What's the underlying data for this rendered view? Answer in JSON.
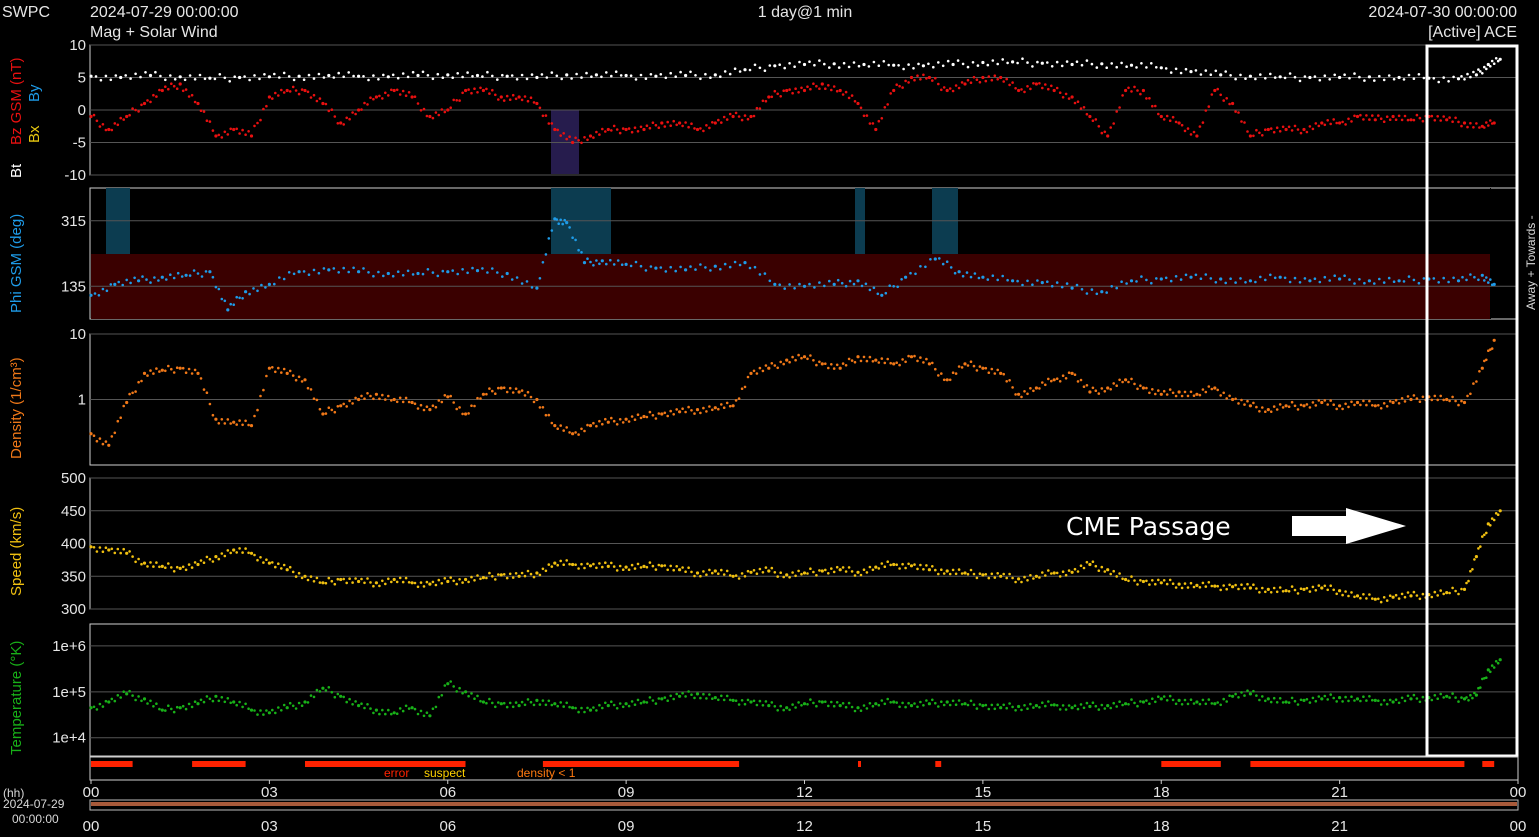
{
  "header": {
    "brand": "SWPC",
    "start_time": "2024-07-29 00:00:00",
    "product": "Mag + Solar Wind",
    "resolution": "1 day@1 min",
    "end_time": "2024-07-30 00:00:00",
    "source": "[Active] ACE"
  },
  "annotation": {
    "text": "CME Passage"
  },
  "right_label": "Away + Towards -",
  "quality_legend": {
    "error": "error",
    "suspect": "suspect",
    "density": "density < 1"
  },
  "bottom_axis": {
    "unit": "(hh)",
    "date": "2024-07-29",
    "time": "00:00:00"
  },
  "colors": {
    "bt": "#ffffff",
    "bz": "#e81010",
    "by": "#1e9be8",
    "bx": "#e8c810",
    "phi": "#1e9be8",
    "density": "#f07818",
    "speed": "#f0c010",
    "temperature": "#18b018",
    "error": "#ff2200",
    "suspect": "#ffd200",
    "density_low": "#ff7a10"
  },
  "chart_data": [
    {
      "type": "scatter",
      "panel": "mag",
      "ylabels": [
        "Bt",
        "Bz GSM (nT)",
        "By",
        "Bx"
      ],
      "yticks": [
        "10",
        "5",
        "0",
        "-5",
        "-10"
      ],
      "ylim": [
        -10,
        10
      ],
      "x_unit": "hours",
      "series": [
        {
          "name": "Bt",
          "x": [
            0,
            0.5,
            1,
            1.5,
            2,
            2.5,
            3,
            3.5,
            4,
            4.5,
            5,
            5.5,
            6,
            6.5,
            7,
            7.5,
            8,
            8.5,
            9,
            9.5,
            10,
            10.5,
            11,
            11.5,
            12,
            12.5,
            13,
            13.5,
            14,
            14.5,
            15,
            15.5,
            16,
            16.5,
            17,
            17.5,
            18,
            18.5,
            19,
            19.5,
            20,
            20.5,
            21,
            21.5,
            22,
            22.5,
            23,
            23.3,
            23.5,
            23.7
          ],
          "y": [
            5.2,
            5.0,
            5.3,
            5.1,
            4.9,
            5.0,
            5.1,
            5.2,
            5.3,
            5.2,
            5.1,
            5.3,
            5.4,
            5.3,
            5.2,
            5.0,
            5.4,
            5.4,
            5.3,
            5.2,
            5.3,
            5.4,
            6.2,
            6.8,
            7.0,
            7.1,
            7.0,
            6.9,
            6.8,
            7.0,
            7.3,
            7.4,
            7.2,
            7.0,
            7.1,
            6.9,
            6.5,
            5.9,
            5.4,
            5.2,
            5.1,
            5.0,
            5.0,
            5.1,
            5.0,
            4.9,
            4.8,
            5.4,
            7.0,
            7.8
          ]
        },
        {
          "name": "Bz GSM (nT)",
          "x": [
            0,
            0.3,
            0.6,
            0.9,
            1.2,
            1.5,
            1.8,
            2.1,
            2.4,
            2.7,
            3.0,
            3.3,
            3.6,
            3.9,
            4.2,
            4.5,
            4.8,
            5.1,
            5.4,
            5.7,
            6.0,
            6.3,
            6.6,
            6.9,
            7.2,
            7.5,
            7.8,
            8.1,
            8.4,
            8.7,
            9.0,
            9.3,
            9.6,
            9.9,
            10.2,
            10.5,
            10.8,
            11.1,
            11.4,
            11.7,
            12.0,
            12.3,
            12.6,
            12.9,
            13.2,
            13.5,
            13.8,
            14.1,
            14.4,
            14.7,
            15.0,
            15.3,
            15.6,
            15.9,
            16.2,
            16.5,
            16.8,
            17.1,
            17.4,
            17.7,
            18.0,
            18.3,
            18.6,
            18.9,
            19.2,
            19.5,
            19.8,
            20.1,
            20.4,
            20.7,
            21.0,
            21.3,
            21.6,
            21.9,
            22.2,
            22.5,
            22.8,
            23.1,
            23.4,
            23.6
          ],
          "y": [
            -1,
            -3,
            -1,
            1,
            3,
            4,
            1,
            -4,
            -3,
            -4,
            2,
            3,
            3,
            1,
            -2,
            0,
            2,
            3,
            2,
            -1,
            0,
            3,
            3,
            2,
            2,
            1,
            -3,
            -5,
            -4,
            -3,
            -3,
            -3,
            -2,
            -2,
            -3,
            -2,
            -1,
            -1,
            2,
            3,
            3,
            4,
            3,
            1,
            -3,
            3,
            5,
            5,
            3,
            4,
            5,
            5,
            3,
            4,
            3,
            2,
            -1,
            -4,
            3,
            3,
            -1,
            -2,
            -4,
            3,
            1,
            -4,
            -3,
            -3,
            -3,
            -2,
            -2,
            -1,
            -1.5,
            -1,
            -1.5,
            -1,
            -1.5,
            -2,
            -2.5,
            -2
          ]
        }
      ]
    },
    {
      "type": "scatter",
      "panel": "phi",
      "ylabels": [
        "Phi GSM (deg)"
      ],
      "yticks": [
        "315",
        "135"
      ],
      "ylim": [
        45,
        405
      ],
      "x_unit": "hours",
      "series": [
        {
          "name": "Phi GSM (deg)",
          "x": [
            0,
            0.4,
            0.8,
            1.2,
            1.6,
            2.0,
            2.3,
            2.6,
            3.0,
            3.5,
            4.0,
            4.5,
            5.0,
            5.5,
            6.0,
            6.5,
            7.0,
            7.5,
            7.8,
            8.0,
            8.3,
            8.6,
            9.0,
            9.5,
            10.0,
            10.5,
            11.0,
            11.5,
            12.0,
            12.5,
            12.9,
            13.3,
            13.7,
            14.2,
            14.6,
            15.0,
            15.5,
            16.0,
            16.5,
            17.0,
            17.5,
            18.0,
            18.5,
            19.0,
            19.5,
            20.0,
            20.5,
            21.0,
            21.5,
            22.0,
            22.5,
            23.0,
            23.4,
            23.6
          ],
          "y": [
            110,
            140,
            150,
            160,
            165,
            175,
            70,
            120,
            140,
            175,
            180,
            175,
            170,
            170,
            175,
            178,
            170,
            130,
            320,
            310,
            200,
            205,
            195,
            185,
            180,
            190,
            200,
            140,
            135,
            140,
            150,
            110,
            160,
            210,
            175,
            160,
            150,
            145,
            130,
            120,
            150,
            155,
            160,
            155,
            150,
            160,
            150,
            155,
            150,
            150,
            155,
            150,
            165,
            140
          ]
        }
      ]
    },
    {
      "type": "scatter",
      "panel": "density",
      "ylabels": [
        "Density (1/cm³)"
      ],
      "yticks": [
        "10",
        "1"
      ],
      "yscale": "log",
      "ylim": [
        0.1,
        10
      ],
      "x_unit": "hours",
      "series": [
        {
          "name": "Density (1/cm³)",
          "x": [
            0,
            0.3,
            0.6,
            0.9,
            1.2,
            1.5,
            1.8,
            2.1,
            2.4,
            2.7,
            3.0,
            3.3,
            3.6,
            3.9,
            4.2,
            4.5,
            4.8,
            5.1,
            5.4,
            5.7,
            6.0,
            6.3,
            6.6,
            6.9,
            7.2,
            7.5,
            7.8,
            8.1,
            8.4,
            8.7,
            9.0,
            9.3,
            9.6,
            9.9,
            10.2,
            10.5,
            10.8,
            11.1,
            11.4,
            11.7,
            12.0,
            12.3,
            12.6,
            12.9,
            13.2,
            13.5,
            13.8,
            14.1,
            14.4,
            14.7,
            15.0,
            15.3,
            15.6,
            15.9,
            16.2,
            16.5,
            16.8,
            17.1,
            17.4,
            17.7,
            18.0,
            18.3,
            18.6,
            18.9,
            19.2,
            19.5,
            19.8,
            20.1,
            20.4,
            20.7,
            21.0,
            21.3,
            21.6,
            21.9,
            22.2,
            22.5,
            22.8,
            23.1,
            23.4,
            23.6
          ],
          "y": [
            0.3,
            0.2,
            0.9,
            2.5,
            2.8,
            3.0,
            2.5,
            0.5,
            0.45,
            0.4,
            3.0,
            2.5,
            2.0,
            0.6,
            0.8,
            1.0,
            1.2,
            1.0,
            0.9,
            0.7,
            1.1,
            0.6,
            1.2,
            1.5,
            1.3,
            1.0,
            0.4,
            0.3,
            0.4,
            0.45,
            0.5,
            0.55,
            0.6,
            0.65,
            0.7,
            0.75,
            0.8,
            2.5,
            3.0,
            4.0,
            4.5,
            3.5,
            3.0,
            4.5,
            4.0,
            3.5,
            4.5,
            3.5,
            2.0,
            3.5,
            3.0,
            2.5,
            1.2,
            1.5,
            2.0,
            2.5,
            1.3,
            1.5,
            2.0,
            1.5,
            1.2,
            1.3,
            1.2,
            1.5,
            1.0,
            0.8,
            0.7,
            0.8,
            0.8,
            0.9,
            0.8,
            0.9,
            0.8,
            0.9,
            1.0,
            1.1,
            1.0,
            0.9,
            3.0,
            8.0
          ]
        }
      ]
    },
    {
      "type": "scatter",
      "panel": "speed",
      "ylabels": [
        "Speed (km/s)"
      ],
      "yticks": [
        "500",
        "450",
        "400",
        "350",
        "300"
      ],
      "ylim": [
        300,
        500
      ],
      "x_unit": "hours",
      "series": [
        {
          "name": "Speed (km/s)",
          "x": [
            0,
            0.3,
            0.6,
            0.9,
            1.2,
            1.5,
            1.8,
            2.1,
            2.4,
            2.7,
            3.0,
            3.3,
            3.6,
            3.9,
            4.2,
            4.5,
            4.8,
            5.1,
            5.4,
            5.7,
            6.0,
            6.3,
            6.6,
            6.9,
            7.2,
            7.5,
            7.8,
            8.1,
            8.4,
            8.7,
            9.0,
            9.3,
            9.6,
            9.9,
            10.2,
            10.5,
            10.8,
            11.1,
            11.4,
            11.7,
            12.0,
            12.3,
            12.6,
            12.9,
            13.2,
            13.5,
            13.8,
            14.1,
            14.4,
            14.7,
            15.0,
            15.3,
            15.6,
            15.9,
            16.2,
            16.5,
            16.8,
            17.1,
            17.4,
            17.7,
            18.0,
            18.3,
            18.6,
            18.9,
            19.2,
            19.5,
            19.8,
            20.1,
            20.4,
            20.7,
            21.0,
            21.3,
            21.6,
            21.9,
            22.2,
            22.5,
            22.8,
            23.1,
            23.3,
            23.5,
            23.7
          ],
          "y": [
            395,
            390,
            385,
            370,
            365,
            362,
            368,
            380,
            390,
            385,
            370,
            360,
            350,
            340,
            345,
            342,
            340,
            345,
            340,
            338,
            342,
            345,
            348,
            352,
            350,
            355,
            370,
            368,
            366,
            365,
            364,
            365,
            366,
            360,
            355,
            358,
            350,
            356,
            358,
            352,
            355,
            358,
            360,
            356,
            364,
            368,
            366,
            360,
            358,
            355,
            352,
            350,
            346,
            350,
            355,
            356,
            368,
            360,
            345,
            342,
            340,
            338,
            336,
            335,
            334,
            332,
            330,
            328,
            330,
            332,
            328,
            320,
            315,
            318,
            320,
            322,
            325,
            330,
            380,
            430,
            450
          ]
        }
      ]
    },
    {
      "type": "scatter",
      "panel": "temperature",
      "ylabels": [
        "Temperature (°K)"
      ],
      "yticks": [
        "1e+6",
        "1e+5",
        "1e+4"
      ],
      "yscale": "log",
      "ylim": [
        4000,
        3000000
      ],
      "x_unit": "hours",
      "series": [
        {
          "name": "Temperature (°K)",
          "x": [
            0,
            0.3,
            0.6,
            0.9,
            1.2,
            1.5,
            1.8,
            2.1,
            2.4,
            2.7,
            3.0,
            3.3,
            3.6,
            3.9,
            4.2,
            4.5,
            4.8,
            5.1,
            5.4,
            5.7,
            6.0,
            6.3,
            6.6,
            6.9,
            7.2,
            7.5,
            7.8,
            8.1,
            8.4,
            8.7,
            9.0,
            9.3,
            9.6,
            9.9,
            10.2,
            10.5,
            10.8,
            11.1,
            11.4,
            11.7,
            12.0,
            12.3,
            12.6,
            12.9,
            13.2,
            13.5,
            13.8,
            14.1,
            14.4,
            14.7,
            15.0,
            15.3,
            15.6,
            15.9,
            16.2,
            16.5,
            16.8,
            17.1,
            17.4,
            17.7,
            18.0,
            18.3,
            18.6,
            18.9,
            19.2,
            19.5,
            19.8,
            20.1,
            20.4,
            20.7,
            21.0,
            21.3,
            21.6,
            21.9,
            22.2,
            22.5,
            22.8,
            23.1,
            23.3,
            23.5,
            23.7
          ],
          "y": [
            45000,
            60000,
            90000,
            70000,
            40000,
            45000,
            55000,
            80000,
            60000,
            40000,
            35000,
            45000,
            60000,
            120000,
            80000,
            50000,
            40000,
            35000,
            45000,
            30000,
            150000,
            100000,
            60000,
            55000,
            50000,
            65000,
            55000,
            45000,
            40000,
            50000,
            55000,
            60000,
            70000,
            80000,
            90000,
            75000,
            65000,
            60000,
            50000,
            45000,
            55000,
            60000,
            50000,
            45000,
            55000,
            60000,
            50000,
            55000,
            60000,
            55000,
            50000,
            45000,
            48000,
            50000,
            52000,
            45000,
            48000,
            50000,
            55000,
            60000,
            70000,
            65000,
            60000,
            55000,
            80000,
            90000,
            70000,
            60000,
            65000,
            70000,
            75000,
            70000,
            65000,
            60000,
            70000,
            75000,
            80000,
            70000,
            85000,
            300000,
            500000
          ]
        }
      ]
    }
  ],
  "x_ticks": [
    "00",
    "03",
    "06",
    "09",
    "12",
    "15",
    "18",
    "21",
    "00"
  ],
  "x_range_hours": [
    0,
    24
  ]
}
